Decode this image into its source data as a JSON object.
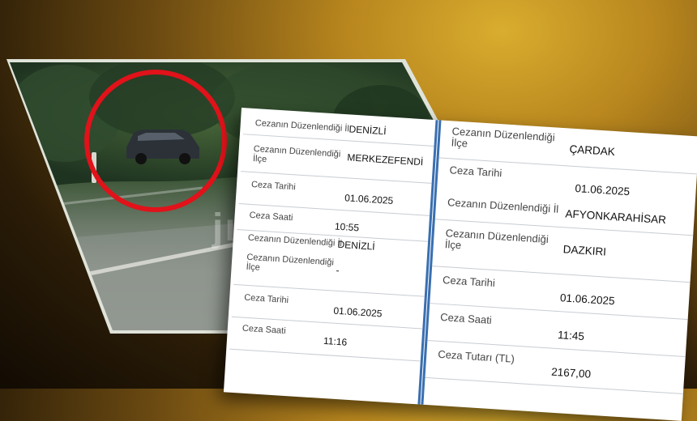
{
  "video": {
    "watermark_text": "jı",
    "highlight_color": "#e0121a"
  },
  "record_left": {
    "rows": [
      {
        "label": "Cezanın Düzenlendiği İl",
        "value": "DENİZLİ"
      },
      {
        "label": "Cezanın Düzenlendiği İlçe",
        "value": "MERKEZEFENDİ"
      },
      {
        "label": "Ceza Tarihi",
        "value": "01.06.2025"
      },
      {
        "label": "Ceza Saati",
        "value": "10:55"
      },
      {
        "label": "Cezanın Düzenlendiği İl",
        "value": "DENİZLİ"
      },
      {
        "label": "Cezanın Düzenlendiği İlçe",
        "value": "-"
      },
      {
        "label": "Ceza Tarihi",
        "value": "01.06.2025"
      },
      {
        "label": "Ceza Saati",
        "value": "11:16"
      }
    ]
  },
  "record_right": {
    "rows": [
      {
        "label": "Cezanın Düzenlendiği İlçe",
        "value": "ÇARDAK"
      },
      {
        "label": "Ceza Tarihi",
        "value": "01.06.2025"
      },
      {
        "label": "Cezanın Düzenlendiği İl",
        "value": "AFYONKARAHİSAR"
      },
      {
        "label": "Cezanın Düzenlendiği İlçe",
        "value": "DAZKIRI"
      },
      {
        "label": "Ceza Tarihi",
        "value": "01.06.2025"
      },
      {
        "label": "Ceza Saati",
        "value": "11:45"
      },
      {
        "label": "Ceza Tutarı (TL)",
        "value": "2167,00"
      }
    ]
  },
  "colors": {
    "divider": "#3a6fb0",
    "background_glow": "#d9ad2e"
  }
}
